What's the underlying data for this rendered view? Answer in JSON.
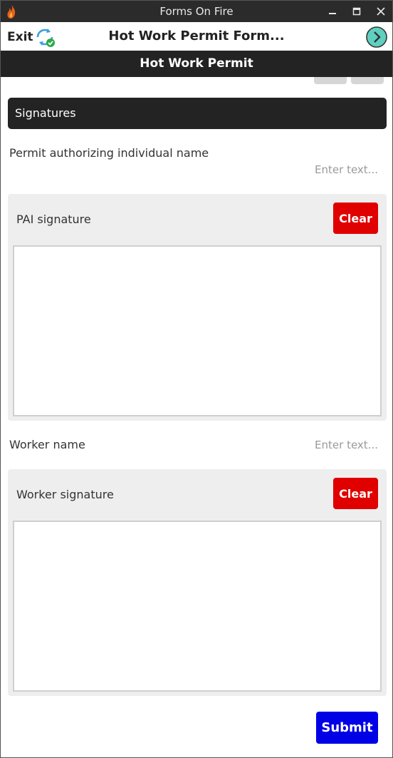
{
  "window": {
    "title": "Forms On Fire"
  },
  "toolbar": {
    "exit_label": "Exit",
    "form_title": "Hot Work Permit Form..."
  },
  "page": {
    "header": "Hot Work Permit"
  },
  "section": {
    "title": "Signatures"
  },
  "pai_name": {
    "label": "Permit authorizing individual name",
    "placeholder": "Enter text..."
  },
  "pai_signature": {
    "label": "PAI signature",
    "clear_label": "Clear"
  },
  "worker_name": {
    "label": "Worker name",
    "placeholder": "Enter text..."
  },
  "worker_signature": {
    "label": "Worker signature",
    "clear_label": "Clear"
  },
  "actions": {
    "submit_label": "Submit"
  },
  "colors": {
    "titlebar": "#2b2b2b",
    "header": "#232323",
    "clear_button": "#e00000",
    "submit_button": "#0000e6",
    "sync_icon": "#3aa0e0",
    "next_icon": "#5fd0c0"
  },
  "icons": {
    "app": "flame-icon",
    "sync": "sync-icon",
    "next": "next-arrow-icon",
    "minimize": "minimize-icon",
    "maximize": "maximize-icon",
    "close": "close-icon"
  }
}
